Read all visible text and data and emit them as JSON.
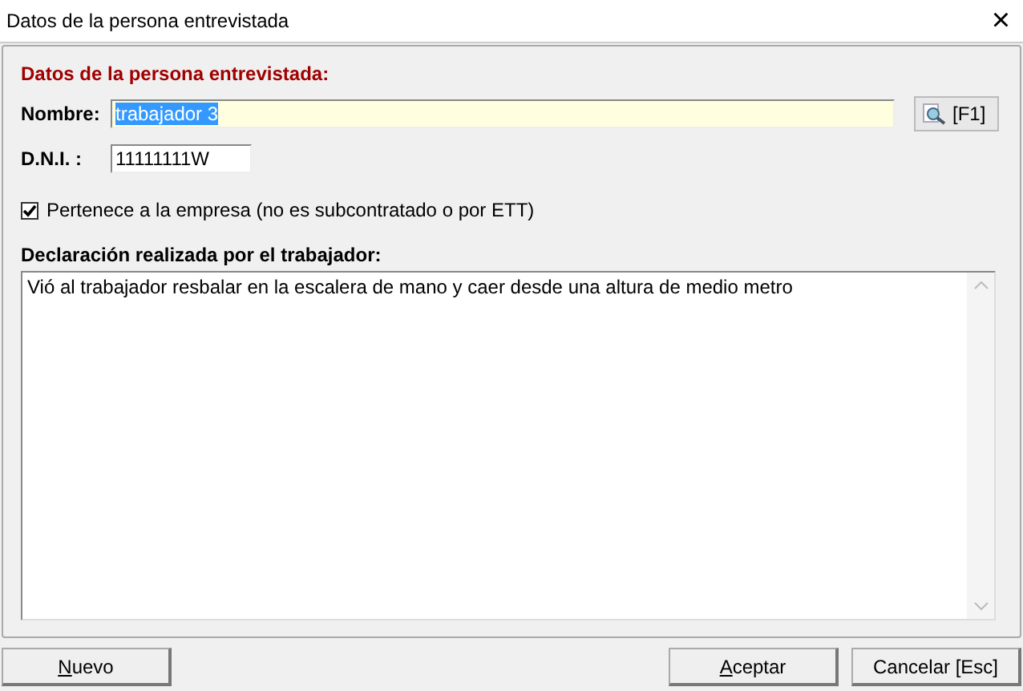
{
  "window": {
    "title": "Datos de la persona entrevistada",
    "close": "×"
  },
  "section_title": "Datos de la persona entrevistada:",
  "nombre": {
    "label": "Nombre:",
    "value": "trabajador 3",
    "selected": true,
    "lookup_button": "[F1]"
  },
  "dni": {
    "label": "D.N.I. :",
    "value": "11111111W"
  },
  "pertenece": {
    "label": "Pertenece a la empresa (no es subcontratado o por ETT)",
    "checked": true
  },
  "declaracion": {
    "label": "Declaración realizada por el trabajador:",
    "value": "Vió al trabajador resbalar en la escalera de mano y caer desde una altura de medio metro"
  },
  "buttons": [
    {
      "kind": "left",
      "label": "Nuevo",
      "first_letter_underlined": true
    },
    {
      "kind": "right",
      "label": "Aceptar",
      "first_letter_underlined": true
    },
    {
      "kind": "right",
      "label": "Cancelar  [Esc]",
      "first_letter_underlined": false
    }
  ]
}
